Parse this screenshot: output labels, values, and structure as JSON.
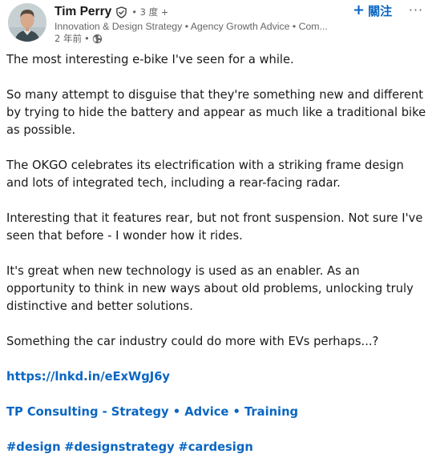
{
  "author": {
    "name": "Tim Perry",
    "degree": "• 3 度 +",
    "headline": "Innovation & Design Strategy • Agency Growth Advice • Com...",
    "timestamp": "2 年前",
    "time_separator": "•",
    "visibility_icon": "globe-icon",
    "verified_icon": "verified-shield-icon"
  },
  "actions": {
    "follow_label": "關注",
    "follow_icon": "+",
    "more_label": "···"
  },
  "body": {
    "paragraphs": [
      "The most interesting e-bike I've seen for a while.",
      "So many attempt to disguise that they're something new and different by trying to hide the battery and appear as much like a traditional bike as possible.",
      "The OKGO celebrates its electrification with a striking frame design and lots of integrated tech, including a rear-facing radar.",
      "Interesting that it features rear, but not front suspension. Not sure I've seen that before - I wonder how it rides.",
      "It's great when new technology is used as an enabler. As an opportunity to think in new ways about old problems, unlocking truly distinctive and better solutions.",
      "Something the car industry could do more with EVs perhaps...?"
    ],
    "link": "https://lnkd.in/eExWgJ6y",
    "company_line": "TP Consulting - Strategy • Advice • Training",
    "hashtags": [
      "#design",
      "#designstrategy",
      "#cardesign"
    ]
  },
  "colors": {
    "link": "#0a66c2",
    "text": "#191919",
    "secondary": "#666666"
  }
}
